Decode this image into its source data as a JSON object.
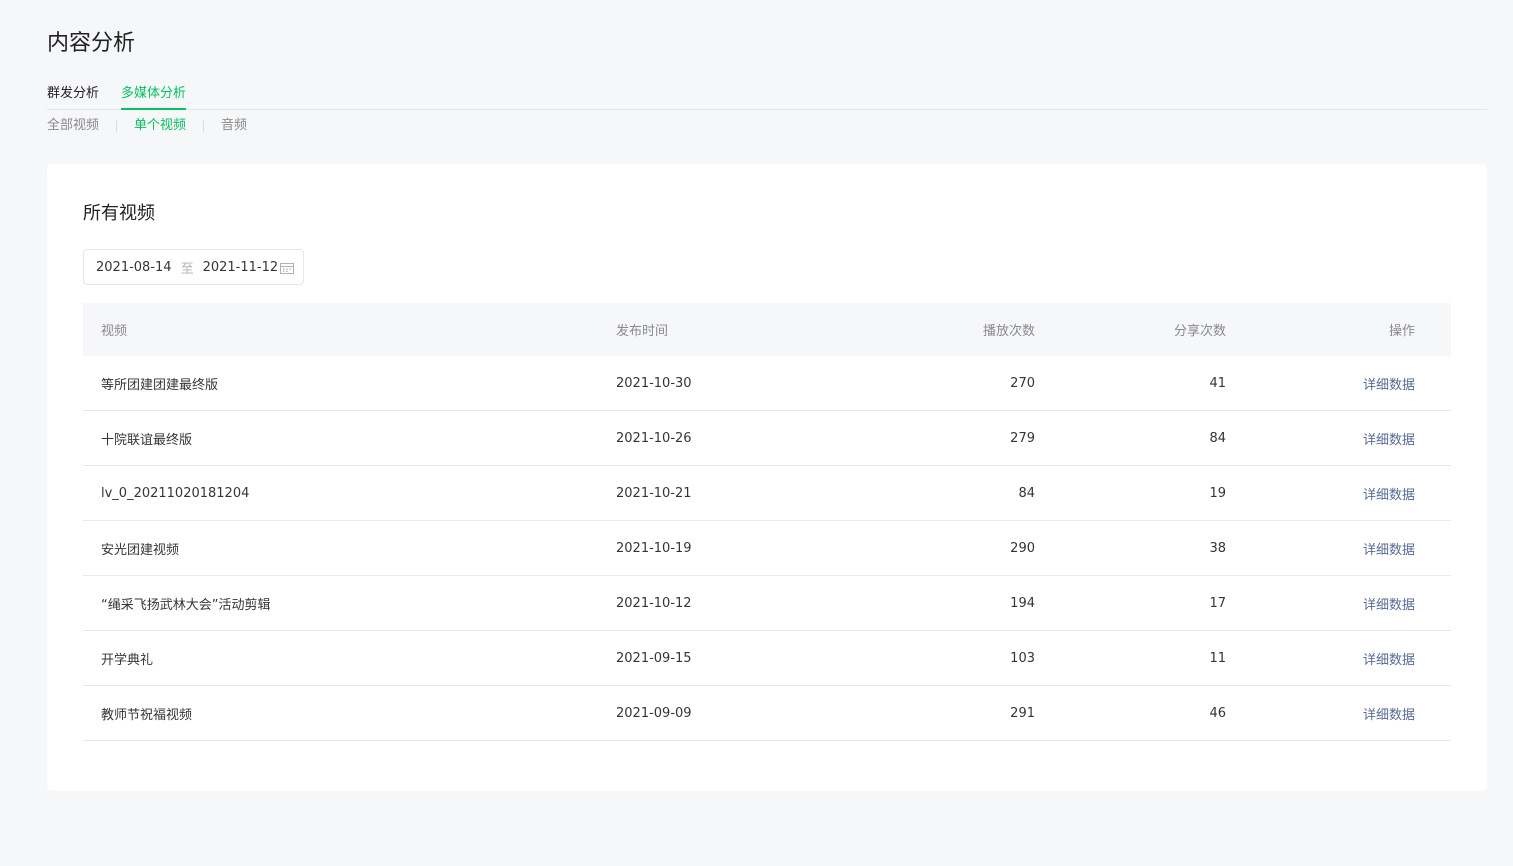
{
  "page_title": "内容分析",
  "main_tabs": [
    {
      "label": "群发分析",
      "active": false
    },
    {
      "label": "多媒体分析",
      "active": true
    }
  ],
  "sub_tabs": [
    {
      "label": "全部视频",
      "active": false
    },
    {
      "label": "单个视频",
      "active": true
    },
    {
      "label": "音频",
      "active": false
    }
  ],
  "card": {
    "title": "所有视频",
    "date_range": {
      "start": "2021-08-14",
      "separator": "至",
      "end": "2021-11-12",
      "icon": "calendar-icon"
    }
  },
  "table": {
    "headers": {
      "name": "视频",
      "date": "发布时间",
      "plays": "播放次数",
      "shares": "分享次数",
      "op": "操作"
    },
    "rows": [
      {
        "name": "等所团建团建最终版",
        "date": "2021-10-30",
        "plays": "270",
        "shares": "41",
        "op": "详细数据"
      },
      {
        "name": "十院联谊最终版",
        "date": "2021-10-26",
        "plays": "279",
        "shares": "84",
        "op": "详细数据"
      },
      {
        "name": "lv_0_20211020181204",
        "date": "2021-10-21",
        "plays": "84",
        "shares": "19",
        "op": "详细数据"
      },
      {
        "name": "安光团建视频",
        "date": "2021-10-19",
        "plays": "290",
        "shares": "38",
        "op": "详细数据"
      },
      {
        "name": "“绳采飞扬武林大会”活动剪辑",
        "date": "2021-10-12",
        "plays": "194",
        "shares": "17",
        "op": "详细数据"
      },
      {
        "name": "开学典礼",
        "date": "2021-09-15",
        "plays": "103",
        "shares": "11",
        "op": "详细数据"
      },
      {
        "name": "教师节祝福视频",
        "date": "2021-09-09",
        "plays": "291",
        "shares": "46",
        "op": "详细数据"
      }
    ]
  },
  "colors": {
    "accent": "#07c160",
    "link": "#576b95",
    "background": "#f6f7f9"
  }
}
